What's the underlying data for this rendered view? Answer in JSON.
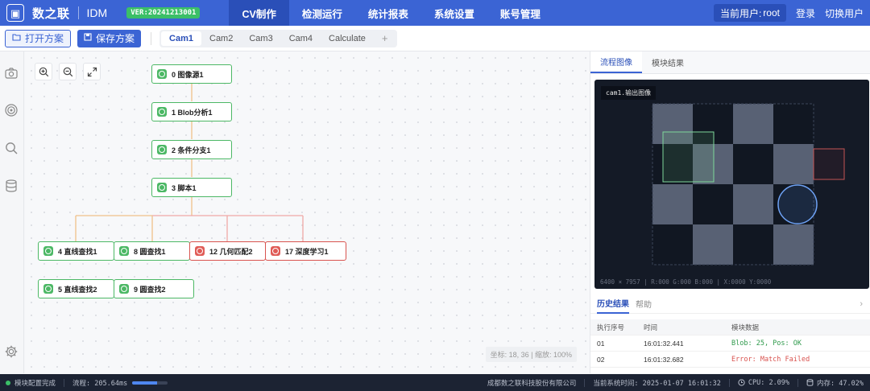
{
  "app": {
    "name": "数之联",
    "product": "IDM",
    "version": "VER:20241213001"
  },
  "nav": [
    {
      "label": "CV制作",
      "active": true
    },
    {
      "label": "检测运行"
    },
    {
      "label": "统计报表"
    },
    {
      "label": "系统设置"
    },
    {
      "label": "账号管理"
    }
  ],
  "user": {
    "prefix": "当前用户:",
    "name": "root",
    "login": "登录",
    "switch": "切换用户"
  },
  "toolbar": {
    "open_label": "打开方案",
    "save_label": "保存方案"
  },
  "tabs": [
    "Cam1",
    "Cam2",
    "Cam3",
    "Cam4",
    "Calculate",
    "+"
  ],
  "flow": {
    "nodes": [
      {
        "label": "0 图像源1",
        "status": "ok"
      },
      {
        "label": "1 Blob分析1",
        "status": "ok"
      },
      {
        "label": "2 条件分支1",
        "status": "ok"
      },
      {
        "label": "3 脚本1",
        "status": "ok"
      },
      {
        "label": "4 直线查找1",
        "status": "ok"
      },
      {
        "label": "8 圆查找1",
        "status": "ok"
      },
      {
        "label": "12 几何匹配2",
        "status": "error"
      },
      {
        "label": "17 深度学习1",
        "status": "error"
      },
      {
        "label": "5 直线查找2",
        "status": "ok"
      },
      {
        "label": "9 圆查找2",
        "status": "ok"
      }
    ],
    "coord_text": "坐标: 18, 36 | 缩放: 100%"
  },
  "right_panel": {
    "tabs": [
      "流程图像",
      "模块结果"
    ],
    "viewer_label": "cam1.输出图像",
    "viewer_footer": "6400 × 7957 | R:000 G:000 B:000 | X:0000 Y:0000",
    "history_tabs": [
      "历史结果",
      "帮助"
    ],
    "table": {
      "headers": [
        "执行序号",
        "时间",
        "模块数据"
      ],
      "rows": [
        {
          "id": "01",
          "time": "16:01:32.441",
          "data": "Blob: 25, Pos: OK",
          "status": "ok"
        },
        {
          "id": "02",
          "time": "16:01:32.682",
          "data": "Error: Match Failed",
          "status": "error"
        }
      ]
    }
  },
  "status_bar": {
    "state": "模块配置完成",
    "flow_time": "流程: 205.64ms",
    "flow_progress": 0.7,
    "company": "成都数之联科技股份有限公司",
    "system_time": "当前系统时间: 2025-01-07 16:01:32",
    "cpu": "CPU: 2.09%",
    "memory": "内存: 47.02%"
  },
  "colors": {
    "brand": "#3b64d4",
    "ok": "#4cb865",
    "error": "#d9534f",
    "statusbar": "#1c2333"
  }
}
